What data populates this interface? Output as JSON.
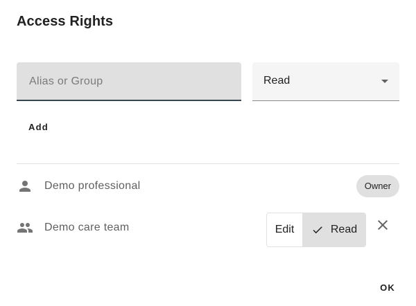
{
  "dialog": {
    "title": "Access Rights"
  },
  "form": {
    "alias_placeholder": "Alias or Group",
    "alias_value": "",
    "permission_selected": "Read",
    "add_label": "Add"
  },
  "members": [
    {
      "name": "Demo professional",
      "icon": "person-icon",
      "badge": "Owner"
    },
    {
      "name": "Demo care team",
      "icon": "group-icon",
      "options": [
        "Edit",
        "Read"
      ],
      "selected": "Read"
    }
  ],
  "footer": {
    "ok_label": "OK"
  },
  "colors": {
    "field_fill": "#e0e0e0",
    "field_underline": "#37474f",
    "chip_fill": "#e0e0e0",
    "icon_gray": "#757575"
  }
}
